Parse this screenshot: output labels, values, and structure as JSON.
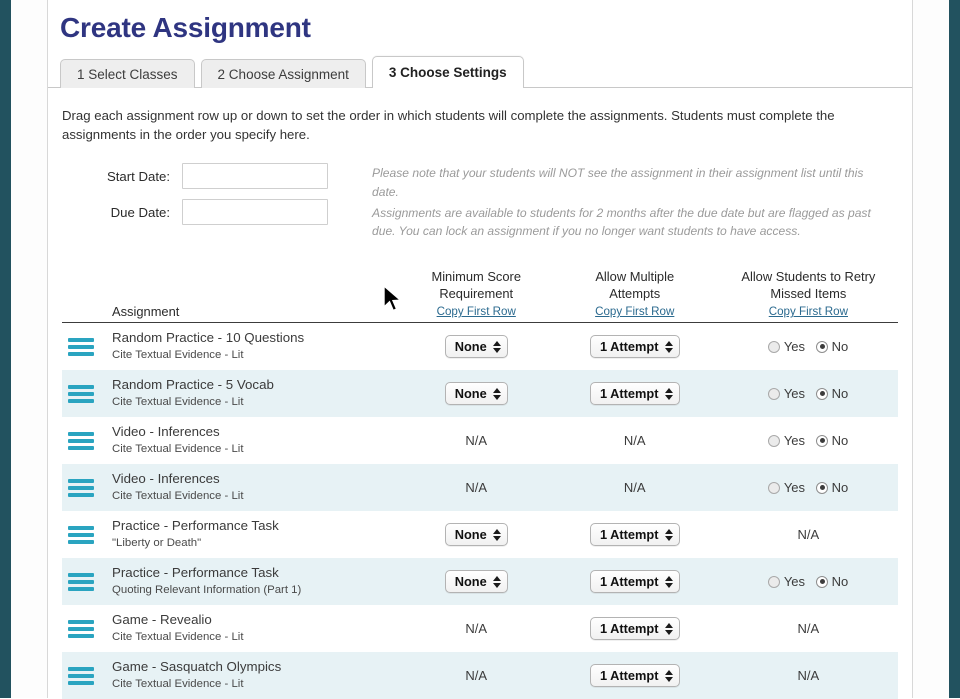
{
  "header": {
    "title": "Create Assignment"
  },
  "tabs": [
    {
      "label": "1 Select Classes",
      "active": false
    },
    {
      "label": "2 Choose Assignment",
      "active": false
    },
    {
      "label": "3 Choose Settings",
      "active": true
    }
  ],
  "instructions": "Drag each assignment row up or down to set the order in which students will complete the assignments. Students must complete the assignments in the order you specify here.",
  "dates": {
    "start": {
      "label": "Start Date:",
      "value": "",
      "placeholder": ""
    },
    "due": {
      "label": "Due Date:",
      "value": "",
      "placeholder": ""
    },
    "notes": [
      "Please note that your students will NOT see the assignment in their assignment list until this date.",
      "Assignments are available to students for 2 months after the due date but are flagged as past due. You can lock an assignment if you no longer want students to have access."
    ]
  },
  "table": {
    "headers": {
      "assignment": "Assignment",
      "min_score_line1": "Minimum Score",
      "min_score_line2": "Requirement",
      "attempts_line1": "Allow Multiple",
      "attempts_line2": "Attempts",
      "retry_line1": "Allow Students to Retry",
      "retry_line2": "Missed Items",
      "copy_first_row": "Copy First Row"
    },
    "radio_yes": "Yes",
    "radio_no": "No",
    "na": "N/A",
    "rows": [
      {
        "title": "Random Practice - 10 Questions",
        "subtitle": "Cite Textual Evidence - Lit",
        "min_score": "None",
        "min_score_type": "select",
        "attempts": "1 Attempt",
        "attempts_type": "select",
        "retry_type": "radio",
        "retry_selected": "No"
      },
      {
        "title": "Random Practice - 5 Vocab",
        "subtitle": "Cite Textual Evidence - Lit",
        "min_score": "None",
        "min_score_type": "select",
        "attempts": "1 Attempt",
        "attempts_type": "select",
        "retry_type": "radio",
        "retry_selected": "No"
      },
      {
        "title": "Video - Inferences",
        "subtitle": "Cite Textual Evidence - Lit",
        "min_score": "N/A",
        "min_score_type": "na",
        "attempts": "N/A",
        "attempts_type": "na",
        "retry_type": "radio",
        "retry_selected": "No"
      },
      {
        "title": "Video - Inferences",
        "subtitle": "Cite Textual Evidence - Lit",
        "min_score": "N/A",
        "min_score_type": "na",
        "attempts": "N/A",
        "attempts_type": "na",
        "retry_type": "radio",
        "retry_selected": "No"
      },
      {
        "title": "Practice - Performance Task",
        "subtitle": "\"Liberty or Death\"",
        "min_score": "None",
        "min_score_type": "select",
        "attempts": "1 Attempt",
        "attempts_type": "select",
        "retry_type": "na",
        "retry_na": "N/A"
      },
      {
        "title": "Practice - Performance Task",
        "subtitle": "Quoting Relevant Information (Part 1)",
        "min_score": "None",
        "min_score_type": "select",
        "attempts": "1 Attempt",
        "attempts_type": "select",
        "retry_type": "radio",
        "retry_selected": "No"
      },
      {
        "title": "Game - Revealio",
        "subtitle": "Cite Textual Evidence - Lit",
        "min_score": "N/A",
        "min_score_type": "na",
        "attempts": "1 Attempt",
        "attempts_type": "select",
        "retry_type": "na",
        "retry_na": "N/A"
      },
      {
        "title": "Game - Sasquatch Olympics",
        "subtitle": "Cite Textual Evidence - Lit",
        "min_score": "N/A",
        "min_score_type": "na",
        "attempts": "1 Attempt",
        "attempts_type": "select",
        "retry_type": "na",
        "retry_na": "N/A"
      }
    ]
  },
  "colors": {
    "title": "#2f3581",
    "edge_strip": "#22525f",
    "drag_handle": "#2aa4c0",
    "row_alt": "#e7f2f5",
    "link": "#2b6a8f"
  }
}
